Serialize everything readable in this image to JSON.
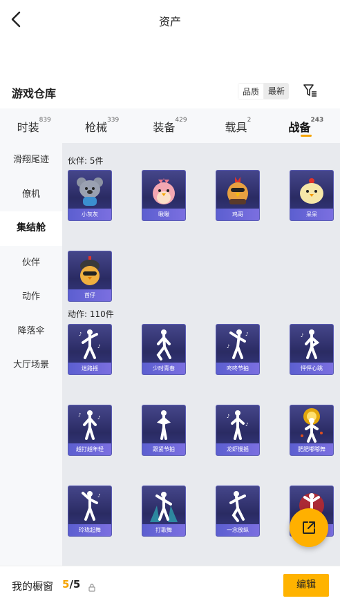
{
  "header": {
    "title": "资产"
  },
  "warehouse": {
    "title": "游戏仓库",
    "sort_quality": "品质",
    "sort_latest": "最新"
  },
  "tabs": [
    {
      "label": "时装",
      "count": "839"
    },
    {
      "label": "枪械",
      "count": "339"
    },
    {
      "label": "装备",
      "count": "429"
    },
    {
      "label": "载具",
      "count": "2"
    },
    {
      "label": "战备",
      "count": "243"
    }
  ],
  "sidebar": {
    "items": [
      {
        "label": "滑翔尾迹"
      },
      {
        "label": "僚机"
      },
      {
        "label": "集结舱"
      },
      {
        "label": "伙伴"
      },
      {
        "label": "动作"
      },
      {
        "label": "降落伞"
      },
      {
        "label": "大厅场景"
      }
    ]
  },
  "partners": {
    "title": "伙伴: 5件",
    "items": [
      {
        "name": "小灰灰"
      },
      {
        "name": "啾啾"
      },
      {
        "name": "鸡哥"
      },
      {
        "name": "呆呆"
      },
      {
        "name": "酋仔"
      }
    ]
  },
  "actions": {
    "title": "动作: 110件",
    "items": [
      {
        "name": "迷路摇"
      },
      {
        "name": "少时青春"
      },
      {
        "name": "咚咚节拍"
      },
      {
        "name": "怦怦心跳"
      },
      {
        "name": "越打越年轻"
      },
      {
        "name": "跟紧节拍"
      },
      {
        "name": "龙虾慢摇"
      },
      {
        "name": "肥肥嘟嘟舞"
      },
      {
        "name": "玲珑起舞"
      },
      {
        "name": "打歌舞"
      },
      {
        "name": "一念放纵"
      },
      {
        "name": ""
      }
    ]
  },
  "bottom": {
    "showcase_label": "我的橱窗",
    "current": "5",
    "total": "/5",
    "edit_label": "编辑"
  },
  "colors": {
    "accent": "#ffb300",
    "card_bg": "#2a2b63",
    "card_label": "#6a66d8"
  }
}
